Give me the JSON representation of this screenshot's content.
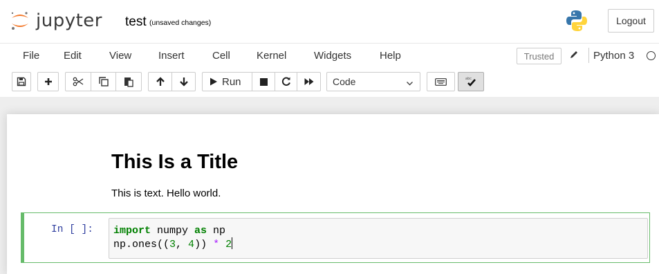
{
  "header": {
    "logo_text": "jupyter",
    "notebook_name": "test",
    "save_status": "(unsaved changes)",
    "logout_label": "Logout"
  },
  "menubar": {
    "items": [
      "File",
      "Edit",
      "View",
      "Insert",
      "Cell",
      "Kernel",
      "Widgets",
      "Help"
    ],
    "trusted_label": "Trusted",
    "kernel_name": "Python 3"
  },
  "toolbar": {
    "run_label": "Run",
    "cell_type": "Code",
    "icons": [
      "save-icon",
      "plus-icon",
      "cut-icon",
      "copy-icon",
      "paste-icon",
      "arrow-up-icon",
      "arrow-down-icon",
      "run-icon",
      "stop-icon",
      "restart-icon",
      "fast-forward-icon",
      "keyboard-icon",
      "spellcheck-icon"
    ]
  },
  "notebook": {
    "markdown_title": "This Is a Title",
    "markdown_text": "This is text. Hello world.",
    "code_cell": {
      "prompt": "In [ ]:",
      "line1": {
        "kw1": "import",
        "mid": " numpy ",
        "kw2": "as",
        "end": " np"
      },
      "line2": {
        "a": "np.ones((",
        "n1": "3",
        "b": ", ",
        "n2": "4",
        "c": ")) ",
        "op": "*",
        "d": " ",
        "n3": "2"
      }
    }
  },
  "colors": {
    "brand_orange": "#f37626",
    "selected_cell_border": "#66bb6a",
    "prompt_in": "#303f9f",
    "keyword": "#008000",
    "operator": "#aa22ff"
  }
}
